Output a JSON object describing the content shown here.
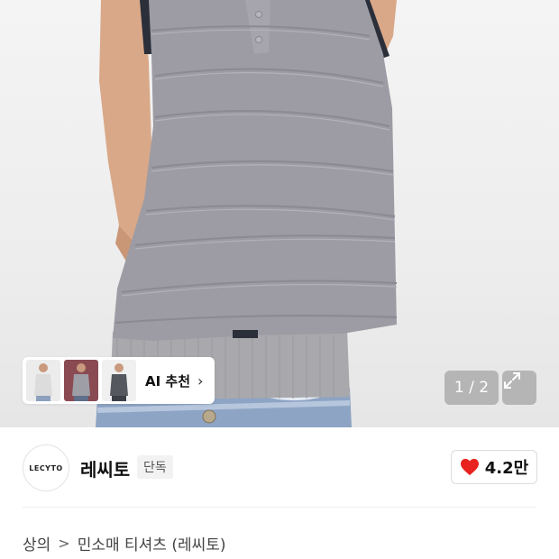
{
  "gallery": {
    "counter_text": "1 / 2",
    "ai_recommend_label": "AI 추천",
    "ai_chevron": "›"
  },
  "brand": {
    "logo_text": "LECYTO",
    "name": "레씨토",
    "badge": "단독",
    "like_count": "4.2만",
    "heart_color": "#e8231f"
  },
  "breadcrumb": {
    "items": [
      "상의",
      "민소매 티셔츠 (레씨토)"
    ],
    "separator": ">"
  }
}
